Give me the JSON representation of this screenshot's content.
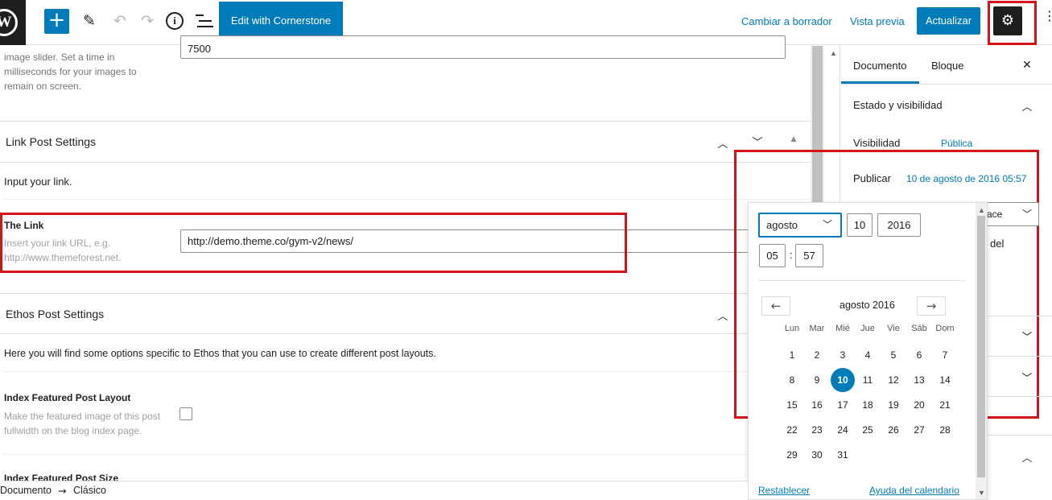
{
  "toolbar": {
    "logo_letter": "W",
    "add_icon": "+",
    "pen_icon": "✎",
    "undo_icon": "↶",
    "redo_icon": "↷",
    "info_icon": "i",
    "cornerstone_label": "Edit with Cornerstone",
    "switch_draft_label": "Cambiar a borrador",
    "preview_label": "Vista previa",
    "update_label": "Actualizar",
    "settings_icon": "⚙",
    "more_icon": "⋮"
  },
  "main": {
    "slider_help": [
      "image slider. Set a time in",
      "milliseconds for your images to",
      "remain on screen."
    ],
    "slider_value": "7500",
    "link_section_title": "Link Post Settings",
    "link_section_desc": "Input your link.",
    "the_link_label": "The Link",
    "the_link_help": [
      "Insert your link URL, e.g.",
      "http://www.themeforest.net."
    ],
    "the_link_value": "http://demo.theme.co/gym-v2/news/",
    "ethos_section_title": "Ethos Post Settings",
    "ethos_section_desc": "Here you will find some options specific to Ethos that you can use to create different post layouts.",
    "index_featured_label": "Index Featured Post Layout",
    "index_featured_help": [
      "Make the featured image of this post",
      "fullwidth on the blog index page."
    ],
    "index_featured_size_label": "Index Featured Post Size"
  },
  "sidebar": {
    "tab_document": "Documento",
    "tab_block": "Bloque",
    "close_icon": "✕",
    "status_panel_title": "Estado y visibilidad",
    "visibility_label": "Visibilidad",
    "visibility_value": "Pública",
    "publish_label": "Publicar",
    "publish_value": "10 de agosto de 2016 05:57",
    "partial_select_text": "ace",
    "partial_text": "del"
  },
  "date_picker": {
    "month": "agosto",
    "day": "10",
    "year": "2016",
    "hour": "05",
    "minute": "57",
    "time_separator": ":",
    "calendar_title": "agosto 2016",
    "prev_icon": "←",
    "next_icon": "→",
    "weekdays": [
      "Lun",
      "Mar",
      "Mié",
      "Jue",
      "Vie",
      "Sáb",
      "Dom"
    ],
    "weeks": [
      [
        "1",
        "2",
        "3",
        "4",
        "5",
        "6",
        "7"
      ],
      [
        "8",
        "9",
        "10",
        "11",
        "12",
        "13",
        "14"
      ],
      [
        "15",
        "16",
        "17",
        "18",
        "19",
        "20",
        "21"
      ],
      [
        "22",
        "23",
        "24",
        "25",
        "26",
        "27",
        "28"
      ],
      [
        "29",
        "30",
        "31",
        "",
        "",
        "",
        ""
      ]
    ],
    "selected_day": "10",
    "reset_label": "Restablecer",
    "help_label": "Ayuda del calendario"
  },
  "footer": {
    "breadcrumb_root": "Documento",
    "breadcrumb_arrow": "→",
    "breadcrumb_leaf": "Clásico"
  },
  "colors": {
    "accent": "#007cba",
    "highlight_red": "#d6131b",
    "dark": "#1e1e1e"
  }
}
